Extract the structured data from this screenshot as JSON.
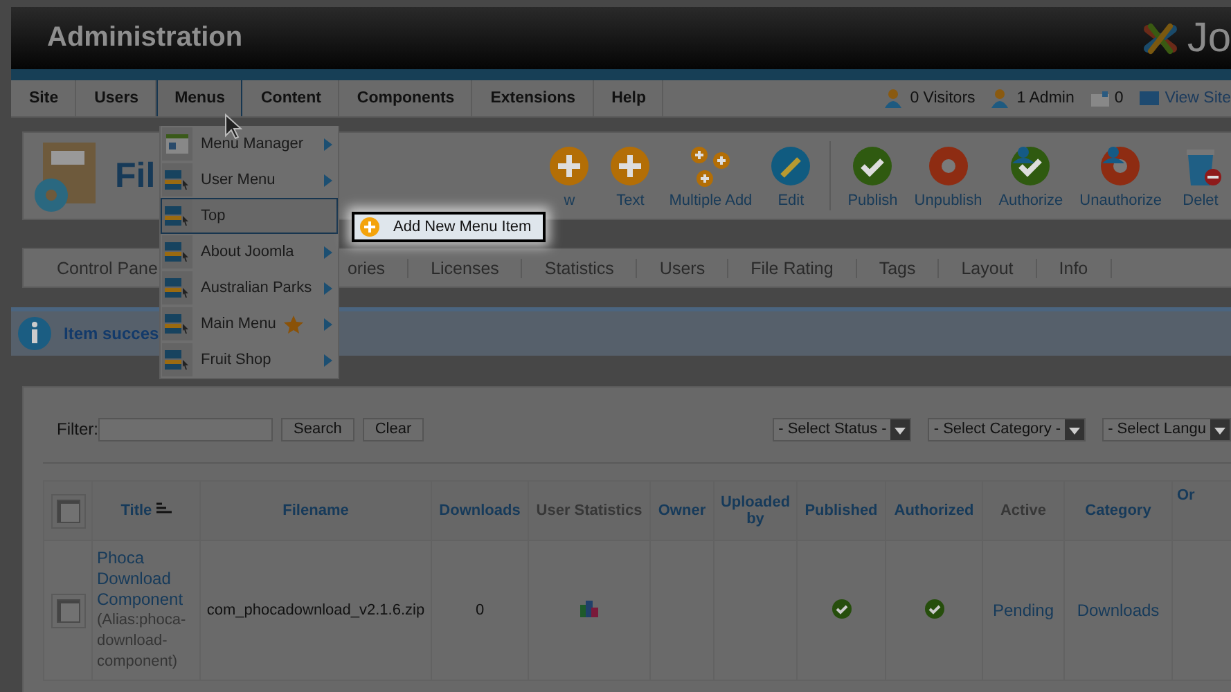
{
  "header": {
    "title": "Administration",
    "logo_text": "Jo"
  },
  "nav": {
    "items": [
      {
        "label": "Site",
        "selected": false
      },
      {
        "label": "Users",
        "selected": false
      },
      {
        "label": "Menus",
        "selected": true
      },
      {
        "label": "Content",
        "selected": false
      },
      {
        "label": "Components",
        "selected": false
      },
      {
        "label": "Extensions",
        "selected": false
      },
      {
        "label": "Help",
        "selected": false
      }
    ],
    "status": [
      {
        "kind": "visitors",
        "label": "0 Visitors"
      },
      {
        "kind": "admins",
        "label": "1 Admin"
      },
      {
        "kind": "messages",
        "label": "0"
      },
      {
        "kind": "site",
        "label": "View Site"
      }
    ]
  },
  "menu_dropdown": {
    "items": [
      {
        "label": "Menu Manager",
        "kind": "manager",
        "selected": false,
        "has_submenu": true,
        "home": false
      },
      {
        "label": "User Menu",
        "kind": "menu",
        "selected": false,
        "has_submenu": true,
        "home": false
      },
      {
        "label": "Top",
        "kind": "menu",
        "selected": true,
        "has_submenu": false,
        "home": false
      },
      {
        "label": "About Joomla",
        "kind": "menu",
        "selected": false,
        "has_submenu": true,
        "home": false
      },
      {
        "label": "Australian Parks",
        "kind": "menu",
        "selected": false,
        "has_submenu": true,
        "home": false
      },
      {
        "label": "Main Menu",
        "kind": "menu",
        "selected": false,
        "has_submenu": true,
        "home": true
      },
      {
        "label": "Fruit Shop",
        "kind": "menu",
        "selected": false,
        "has_submenu": true,
        "home": false
      }
    ]
  },
  "submenu": {
    "items": [
      {
        "label": "Add New Menu Item"
      }
    ]
  },
  "toolbar": {
    "title": "Fil",
    "buttons": [
      {
        "label": "w",
        "kind": "add"
      },
      {
        "label": "Text",
        "kind": "add"
      },
      {
        "label": "Multiple Add",
        "kind": "multi"
      },
      {
        "label": "Edit",
        "kind": "edit"
      },
      {
        "kind": "separator"
      },
      {
        "label": "Publish",
        "kind": "publish"
      },
      {
        "label": "Unpublish",
        "kind": "unpublish"
      },
      {
        "label": "Authorize",
        "kind": "authorize"
      },
      {
        "label": "Unauthorize",
        "kind": "unauthorize"
      },
      {
        "label": "Delet",
        "kind": "delete"
      }
    ]
  },
  "tabs": [
    "Control Pane",
    "ories",
    "Licenses",
    "Statistics",
    "Users",
    "File Rating",
    "Tags",
    "Layout",
    "Info"
  ],
  "message": {
    "text": "Item succes"
  },
  "filter": {
    "label": "Filter:",
    "buttons": [
      "Search",
      "Clear"
    ],
    "selects": [
      "- Select Status -",
      "- Select Category -",
      "- Select Langu"
    ]
  },
  "table": {
    "header_checked": false,
    "columns": [
      {
        "label": "Title",
        "link": true,
        "sorted": true
      },
      {
        "label": "Filename",
        "link": true,
        "sorted": false
      },
      {
        "label": "Downloads",
        "link": true,
        "sorted": false
      },
      {
        "label": "User Statistics",
        "link": false,
        "sorted": false
      },
      {
        "label": "Owner",
        "link": true,
        "sorted": false
      },
      {
        "label": "Uploaded by",
        "link": true,
        "sorted": false
      },
      {
        "label": "Published",
        "link": true,
        "sorted": false
      },
      {
        "label": "Authorized",
        "link": true,
        "sorted": false
      },
      {
        "label": "Active",
        "link": false,
        "sorted": false
      },
      {
        "label": "Category",
        "link": true,
        "sorted": false
      },
      {
        "label": "Or",
        "link": true,
        "sorted": false
      }
    ],
    "rows": [
      {
        "checked": false,
        "title": "Phoca Download Component",
        "alias": "(Alias:phoca-download-component)",
        "filename": "com_phocadownload_v2.1.6.zip",
        "downloads": "0",
        "published": true,
        "authorized": true,
        "active": "Pending",
        "category": "Downloads"
      }
    ]
  }
}
